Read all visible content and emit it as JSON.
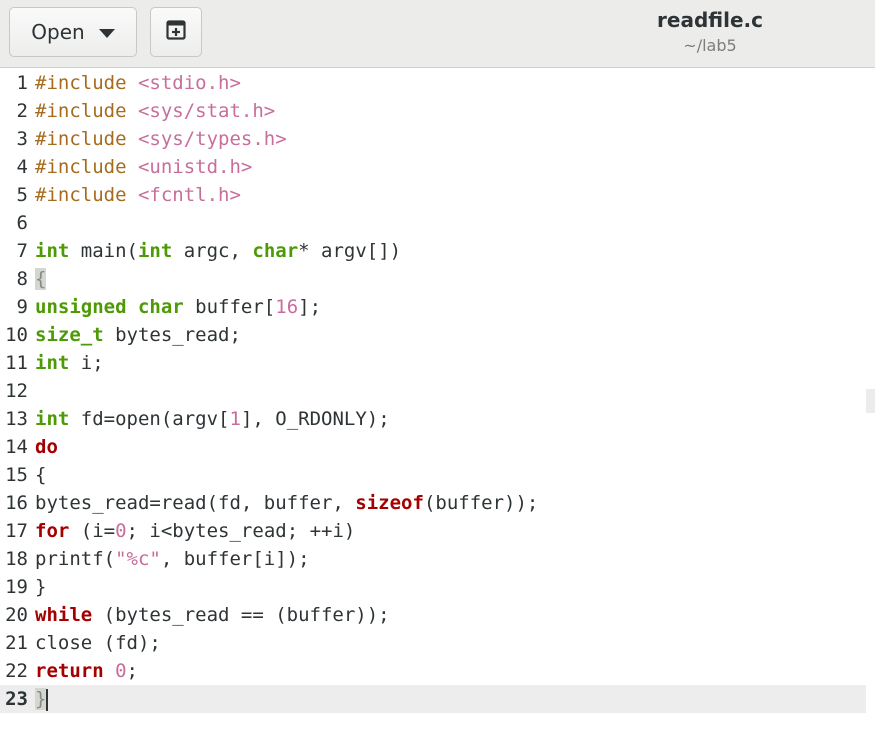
{
  "header": {
    "open_label": "Open",
    "title": "readfile.c",
    "subtitle": "~/lab5"
  },
  "editor": {
    "current_line": 23,
    "lines": [
      {
        "num": "1",
        "tokens": [
          {
            "t": "#include ",
            "c": "kw-include"
          },
          {
            "t": "<stdio.h>",
            "c": "str-inc"
          }
        ]
      },
      {
        "num": "2",
        "tokens": [
          {
            "t": "#include ",
            "c": "kw-include"
          },
          {
            "t": "<sys/stat.h>",
            "c": "str-inc"
          }
        ]
      },
      {
        "num": "3",
        "tokens": [
          {
            "t": "#include ",
            "c": "kw-include"
          },
          {
            "t": "<sys/types.h>",
            "c": "str-inc"
          }
        ]
      },
      {
        "num": "4",
        "tokens": [
          {
            "t": "#include ",
            "c": "kw-include"
          },
          {
            "t": "<unistd.h>",
            "c": "str-inc"
          }
        ]
      },
      {
        "num": "5",
        "tokens": [
          {
            "t": "#include ",
            "c": "kw-include"
          },
          {
            "t": "<fcntl.h>",
            "c": "str-inc"
          }
        ]
      },
      {
        "num": "6",
        "tokens": []
      },
      {
        "num": "7",
        "tokens": [
          {
            "t": "int",
            "c": "kw-type"
          },
          {
            "t": " main("
          },
          {
            "t": "int",
            "c": "kw-type"
          },
          {
            "t": " argc, "
          },
          {
            "t": "char",
            "c": "kw-type"
          },
          {
            "t": "* argv[])"
          }
        ]
      },
      {
        "num": "8",
        "tokens": [
          {
            "t": "{",
            "c": "brace-match"
          }
        ]
      },
      {
        "num": "9",
        "tokens": [
          {
            "t": "unsigned",
            "c": "kw-type"
          },
          {
            "t": " "
          },
          {
            "t": "char",
            "c": "kw-type"
          },
          {
            "t": " buffer["
          },
          {
            "t": "16",
            "c": "num"
          },
          {
            "t": "];"
          }
        ]
      },
      {
        "num": "10",
        "tokens": [
          {
            "t": "size_t",
            "c": "kw-type"
          },
          {
            "t": " bytes_read;"
          }
        ]
      },
      {
        "num": "11",
        "tokens": [
          {
            "t": "int",
            "c": "kw-type"
          },
          {
            "t": " i;"
          }
        ]
      },
      {
        "num": "12",
        "tokens": []
      },
      {
        "num": "13",
        "tokens": [
          {
            "t": "int",
            "c": "kw-type"
          },
          {
            "t": " fd=open(argv["
          },
          {
            "t": "1",
            "c": "num"
          },
          {
            "t": "], O_RDONLY);"
          }
        ]
      },
      {
        "num": "14",
        "tokens": [
          {
            "t": "do",
            "c": "kw-ctrl"
          }
        ]
      },
      {
        "num": "15",
        "tokens": [
          {
            "t": "{"
          }
        ]
      },
      {
        "num": "16",
        "tokens": [
          {
            "t": "bytes_read=read(fd, buffer, "
          },
          {
            "t": "sizeof",
            "c": "kw-ctrl"
          },
          {
            "t": "(buffer));"
          }
        ]
      },
      {
        "num": "17",
        "tokens": [
          {
            "t": "for",
            "c": "kw-ctrl"
          },
          {
            "t": " (i="
          },
          {
            "t": "0",
            "c": "num"
          },
          {
            "t": "; i<bytes_read; ++i)"
          }
        ]
      },
      {
        "num": "18",
        "tokens": [
          {
            "t": "printf("
          },
          {
            "t": "\"%c\"",
            "c": "str"
          },
          {
            "t": ", buffer[i]);"
          }
        ]
      },
      {
        "num": "19",
        "tokens": [
          {
            "t": "}"
          }
        ]
      },
      {
        "num": "20",
        "tokens": [
          {
            "t": "while",
            "c": "kw-ctrl"
          },
          {
            "t": " (bytes_read == (buffer));"
          }
        ]
      },
      {
        "num": "21",
        "tokens": [
          {
            "t": "close (fd);"
          }
        ]
      },
      {
        "num": "22",
        "tokens": [
          {
            "t": "return",
            "c": "kw-ctrl"
          },
          {
            "t": " "
          },
          {
            "t": "0",
            "c": "num"
          },
          {
            "t": ";"
          }
        ]
      },
      {
        "num": "23",
        "tokens": [
          {
            "t": "}",
            "c": "brace-match"
          }
        ]
      }
    ]
  }
}
